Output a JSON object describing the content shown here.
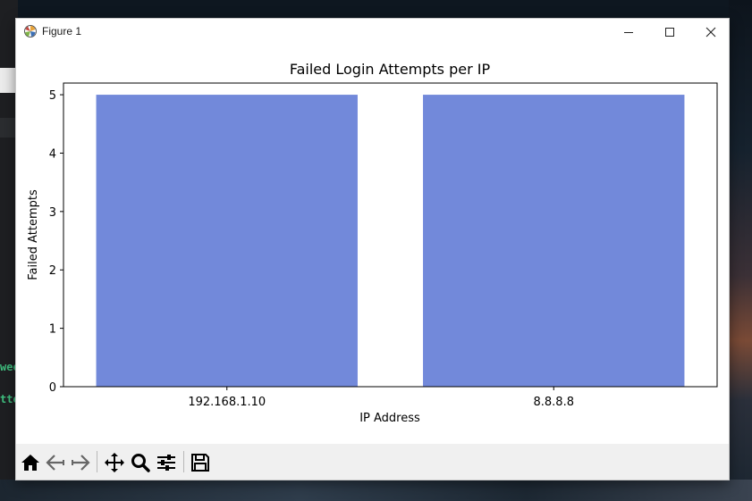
{
  "window": {
    "title": "Figure 1"
  },
  "background": {
    "code_lines": [
      "wee",
      "tte"
    ]
  },
  "toolbar": {
    "buttons": [
      "home-icon",
      "back-arrow-icon",
      "forward-arrow-icon",
      "pan-icon",
      "zoom-icon",
      "configure-subplots-icon",
      "save-icon"
    ]
  },
  "colors": {
    "bar": "#7289da",
    "axis": "#000000"
  },
  "chart_data": {
    "type": "bar",
    "title": "Failed Login Attempts per IP",
    "xlabel": "IP Address",
    "ylabel": "Failed Attempts",
    "categories": [
      "192.168.1.10",
      "8.8.8.8"
    ],
    "values": [
      5,
      5
    ],
    "ylim": [
      0,
      5.2
    ],
    "yticks": [
      0,
      1,
      2,
      3,
      4,
      5
    ],
    "grid": false,
    "legend": "none"
  }
}
